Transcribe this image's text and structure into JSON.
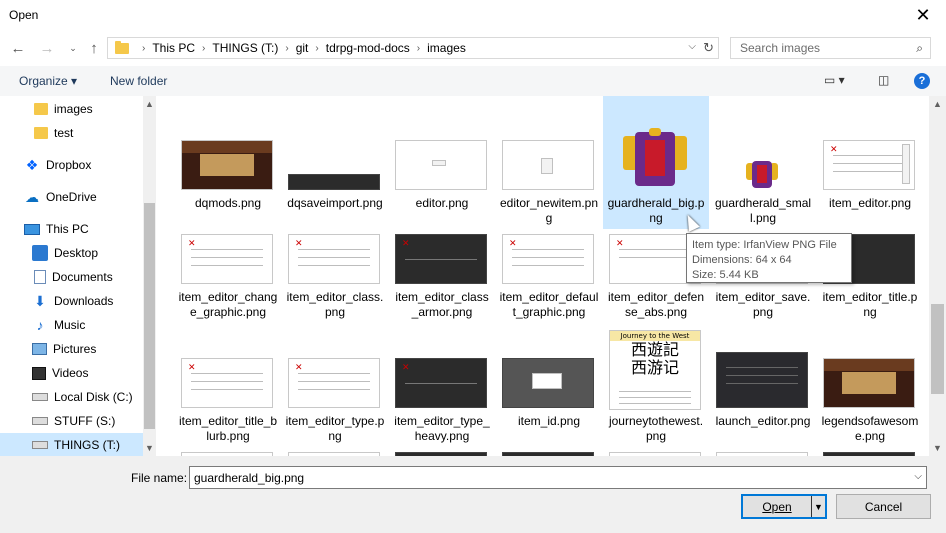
{
  "window": {
    "title": "Open",
    "close_icon": "close-icon"
  },
  "nav": {
    "back_icon": "back-arrow-icon",
    "forward_icon": "forward-arrow-icon",
    "recent_icon": "chevron-down-icon",
    "up_icon": "up-arrow-icon",
    "breadcrumb": [
      "This PC",
      "THINGS (T:)",
      "git",
      "tdrpg-mod-docs",
      "images"
    ],
    "search_placeholder": "Search images"
  },
  "toolbar": {
    "organize": "Organize ▾",
    "new_folder": "New folder",
    "help": "?"
  },
  "sidebar": {
    "items": [
      {
        "label": "images",
        "icon": "folder-icon"
      },
      {
        "label": "test",
        "icon": "folder-icon"
      },
      {
        "label": "Dropbox",
        "icon": "dropbox-icon"
      },
      {
        "label": "OneDrive",
        "icon": "cloud-icon"
      },
      {
        "label": "This PC",
        "icon": "computer-icon"
      },
      {
        "label": "Desktop",
        "icon": "desktop-icon"
      },
      {
        "label": "Documents",
        "icon": "documents-icon"
      },
      {
        "label": "Downloads",
        "icon": "download-icon"
      },
      {
        "label": "Music",
        "icon": "music-icon"
      },
      {
        "label": "Pictures",
        "icon": "pictures-icon"
      },
      {
        "label": "Videos",
        "icon": "videos-icon"
      },
      {
        "label": "Local Disk (C:)",
        "icon": "drive-icon"
      },
      {
        "label": "STUFF (S:)",
        "icon": "drive-icon"
      },
      {
        "label": "THINGS (T:)",
        "icon": "drive-icon"
      }
    ],
    "selected": "THINGS (T:)"
  },
  "files": [
    {
      "name": "dqmods.png",
      "thumb": "game"
    },
    {
      "name": "dqsaveimport.png",
      "thumb": "dark"
    },
    {
      "name": "editor.png",
      "thumb": "light"
    },
    {
      "name": "editor_newitem.png",
      "thumb": "light"
    },
    {
      "name": "guardherald_big.png",
      "thumb": "armor"
    },
    {
      "name": "guardherald_small.png",
      "thumb": "armor-small"
    },
    {
      "name": "item_editor.png",
      "thumb": "form"
    },
    {
      "name": "item_editor_change_graphic.png",
      "thumb": "form"
    },
    {
      "name": "item_editor_class.png",
      "thumb": "form"
    },
    {
      "name": "item_editor_class_armor.png",
      "thumb": "form-dark"
    },
    {
      "name": "item_editor_default_graphic.png",
      "thumb": "form"
    },
    {
      "name": "item_editor_defense_abs.png",
      "thumb": "form"
    },
    {
      "name": "item_editor_save.png",
      "thumb": "form"
    },
    {
      "name": "item_editor_title.png",
      "thumb": "form-dark"
    },
    {
      "name": "item_editor_title_blurb.png",
      "thumb": "form"
    },
    {
      "name": "item_editor_type.png",
      "thumb": "form"
    },
    {
      "name": "item_editor_type_heavy.png",
      "thumb": "form-dark"
    },
    {
      "name": "item_id.png",
      "thumb": "dark"
    },
    {
      "name": "journeytothewest.png",
      "thumb": "text"
    },
    {
      "name": "launch_editor.png",
      "thumb": "dark"
    },
    {
      "name": "legendsofawesome.png",
      "thumb": "game"
    }
  ],
  "selected_file": "guardherald_big.png",
  "tooltip": {
    "type": "Item type: IrfanView PNG File",
    "dimensions": "Dimensions: 64 x 64",
    "size": "Size: 5.44 KB"
  },
  "footer": {
    "file_name_label": "File name:",
    "file_name_value": "guardherald_big.png",
    "open_label": "Open",
    "cancel_label": "Cancel"
  },
  "journey_text": {
    "header": "Journey to the West",
    "chars1": "西遊記",
    "chars2": "西游记"
  }
}
